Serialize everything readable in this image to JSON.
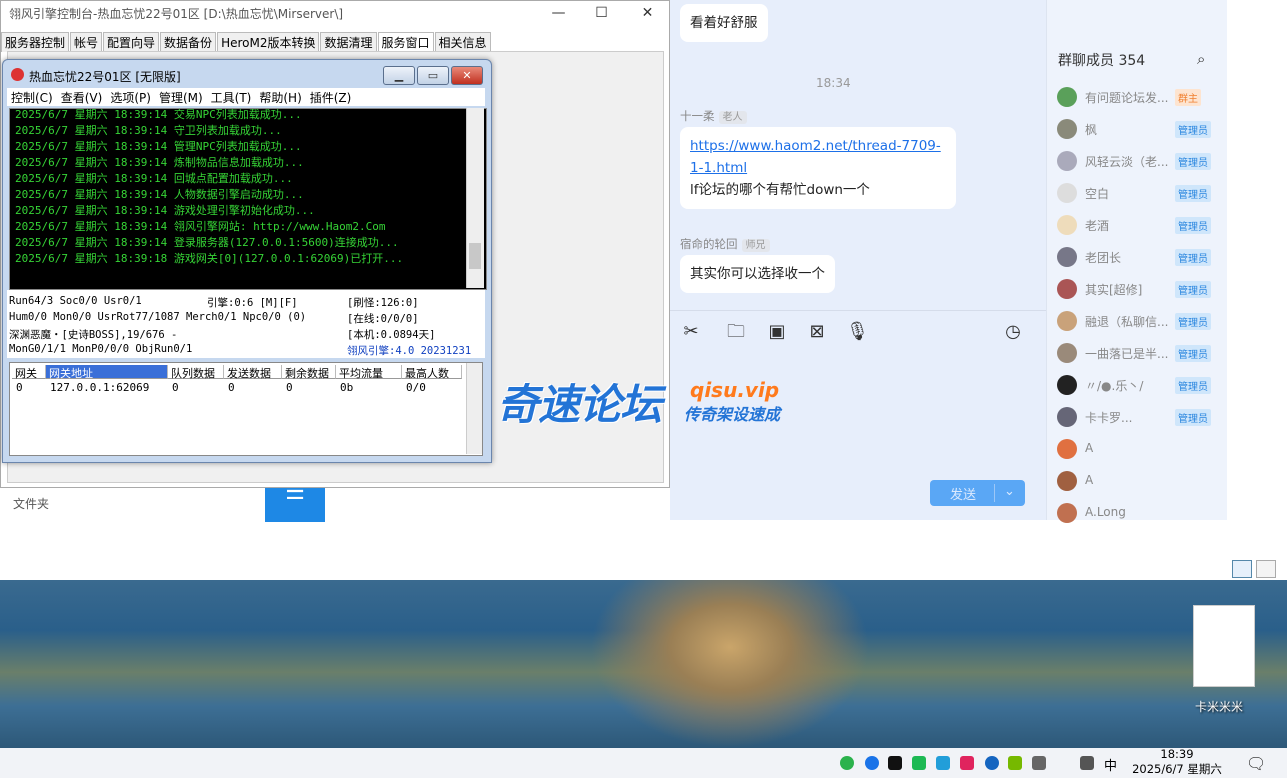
{
  "desktop": {
    "file_label": "卡米米米"
  },
  "control_window": {
    "title": "翎风引擎控制台-热血忘忧22号01区 [D:\\热血忘忧\\Mirserver\\]",
    "minimize": "—",
    "maximize": "☐",
    "close": "✕",
    "tabs": [
      "服务器控制",
      "帐号",
      "配置向导",
      "数据备份",
      "HeroM2版本转换",
      "数据清理",
      "服务窗口",
      "相关信息"
    ],
    "active_tab": "服务窗口",
    "folder_label": "文件夹"
  },
  "server_window": {
    "title": "热血忘忧22号01区 [无限版]",
    "menu": [
      "控制(C)",
      "查看(V)",
      "选项(P)",
      "管理(M)",
      "工具(T)",
      "帮助(H)",
      "插件(Z)"
    ],
    "console_lines": [
      "2025/6/7 星期六 18:39:14 交易NPC列表加载成功...",
      "2025/6/7 星期六 18:39:14 守卫列表加载成功...",
      "2025/6/7 星期六 18:39:14 管理NPC列表加载成功...",
      "2025/6/7 星期六 18:39:14 炼制物品信息加载成功...",
      "2025/6/7 星期六 18:39:14 回城点配置加载成功...",
      "2025/6/7 星期六 18:39:14 人物数据引擎启动成功...",
      "2025/6/7 星期六 18:39:14 游戏处理引擎初始化成功...",
      "2025/6/7 星期六 18:39:14 翎风引擎网站: http://www.Haom2.Com",
      "2025/6/7 星期六 18:39:14 登录服务器(127.0.0.1:5600)连接成功...",
      "2025/6/7 星期六 18:39:18 游戏网关[0](127.0.0.1:62069)已打开..."
    ],
    "stats": {
      "run": "Run64/3 Soc0/0 Usr0/1",
      "engine": "引擎:0:6 [M][F]",
      "refresh": "[刷怪:126:0]",
      "hum": "Hum0/0 Mon0/0 UsrRot77/1087 Merch0/1 Npc0/0 (0)",
      "online": "[在线:0/0/0]",
      "boss": "深渊恶魔・[史诗BOSS],19/676 -",
      "local": "[本机:0.0894天]",
      "mong": "MonG0/1/1 MonP0/0/0 ObjRun0/1",
      "version": "翎风引擎:4.0 20231231"
    },
    "gateway_table": {
      "headers": [
        "网关",
        "网关地址",
        "队列数据",
        "发送数据",
        "剩余数据",
        "平均流量",
        "最高人数"
      ],
      "rows": [
        [
          "0",
          "127.0.0.1:62069",
          "0",
          "0",
          "0",
          "0b",
          "0/0"
        ]
      ]
    }
  },
  "watermark": {
    "main": "奇速论坛",
    "url": "qisu.vip",
    "sub": "传奇架设速成"
  },
  "chat": {
    "msg_top": "看着好舒服",
    "time": "18:34",
    "sender1": "十一柔",
    "sender1_tag": "老人",
    "link_text": "https://www.haom2.net/thread-7709-1-1.html",
    "msg1": "lf论坛的哪个有帮忙down一个",
    "sender2": "宿命的轮回",
    "sender2_tag": "师兄",
    "msg2": "其实你可以选择收一个",
    "send_label": "发送",
    "members_title": "群聊成员 354",
    "members": [
      {
        "name": "有问题论坛发...",
        "role": "群主",
        "color": "#5aa05a"
      },
      {
        "name": "枫",
        "role": "管理员",
        "color": "#8a8a7a"
      },
      {
        "name": "风轻云淡（老...",
        "role": "管理员",
        "color": "#aab"
      },
      {
        "name": "空白",
        "role": "管理员",
        "color": "#ddd"
      },
      {
        "name": "老酒",
        "role": "管理员",
        "color": "#eedcbb"
      },
      {
        "name": "老团长",
        "role": "管理员",
        "color": "#778"
      },
      {
        "name": "其实[超修]",
        "role": "管理员",
        "color": "#a55"
      },
      {
        "name": "融退（私聊信...",
        "role": "管理员",
        "color": "#c9a27a"
      },
      {
        "name": "一曲落已是半...",
        "role": "管理员",
        "color": "#9a8a7a"
      },
      {
        "name": "〃/●.乐丶/",
        "role": "管理员",
        "color": "#222"
      },
      {
        "name": "卡卡罗...",
        "role": "管理员",
        "color": "#667"
      },
      {
        "name": "A",
        "role": "",
        "color": "#e07040"
      },
      {
        "name": "A",
        "role": "",
        "color": "#a06040"
      },
      {
        "name": "A.Long",
        "role": "",
        "color": "#c07050"
      }
    ]
  },
  "taskbar": {
    "ime": "中",
    "time": "18:39",
    "date": "2025/6/7 星期六"
  }
}
